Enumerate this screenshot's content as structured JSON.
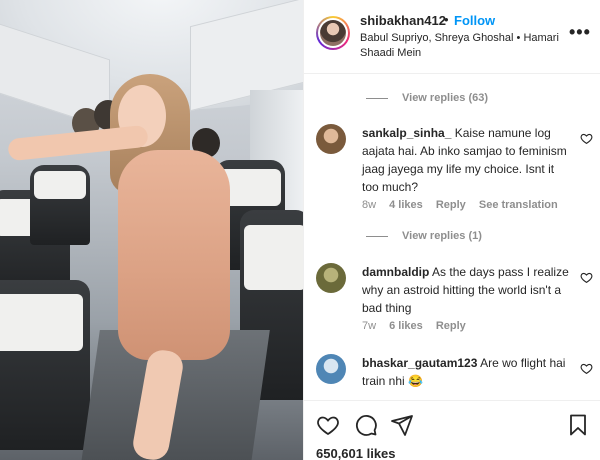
{
  "post": {
    "username": "shibakhan412",
    "separator": "•",
    "follow_label": "Follow",
    "audio": "Babul Supriyo, Shreya Ghoshal • Hamari Shaadi Mein",
    "more_icon": "more-options-icon"
  },
  "comments": {
    "view_replies_1": "View replies (63)",
    "items": [
      {
        "username": "sankalp_sinha_",
        "text": "Kaise namune log aajata hai. Ab inko samjao to feminism jaag jayega my life my choice. Isnt it too much?",
        "age": "8w",
        "likes": "4 likes",
        "reply": "Reply",
        "translate": "See translation",
        "avatar_color": "#7a5a3c"
      },
      {
        "username": "damnbaldip",
        "text": "As the days pass I realize why an astroid hitting the world isn't a bad thing",
        "age": "7w",
        "likes": "6 likes",
        "reply": "Reply",
        "avatar_color": "#6b6a3a"
      },
      {
        "username": "bhaskar_gautam123",
        "text": "Are wo flight hai train nhi 😂",
        "avatar_color": "#4f86b5"
      }
    ],
    "view_replies_2": "View replies (1)"
  },
  "actions": {
    "icons": [
      "heart-icon",
      "comment-icon",
      "share-icon",
      "bookmark-icon"
    ],
    "likes": "650,601 likes"
  },
  "colors": {
    "link_blue": "#0095f6",
    "muted": "#8e8e8e",
    "text": "#262626"
  }
}
